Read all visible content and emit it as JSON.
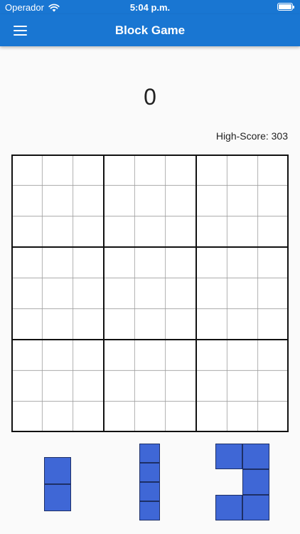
{
  "status_bar": {
    "carrier": "Operador",
    "time": "5:04 p.m."
  },
  "app_bar": {
    "title": "Block Game",
    "menu_icon": "hamburger-menu-icon"
  },
  "game": {
    "score": "0",
    "high_score_label": "High-Score: 303",
    "board": {
      "rows": 9,
      "cols": 9,
      "filled_cells": []
    },
    "pieces": [
      {
        "name": "vertical-domino",
        "cells": [
          [
            0,
            0
          ],
          [
            1,
            0
          ]
        ]
      },
      {
        "name": "vertical-i-four",
        "cells": [
          [
            0,
            0
          ],
          [
            1,
            0
          ],
          [
            2,
            0
          ],
          [
            3,
            0
          ]
        ]
      },
      {
        "name": "c-shape",
        "cells": [
          [
            0,
            0
          ],
          [
            0,
            1
          ],
          [
            1,
            1
          ],
          [
            2,
            0
          ],
          [
            2,
            1
          ]
        ]
      }
    ]
  },
  "colors": {
    "primary": "#1976d2",
    "piece_fill": "#3f67d6",
    "piece_border": "#1d2f66",
    "grid_line": "#9e9e9e",
    "grid_thick": "#111111",
    "background": "#fafafa"
  }
}
